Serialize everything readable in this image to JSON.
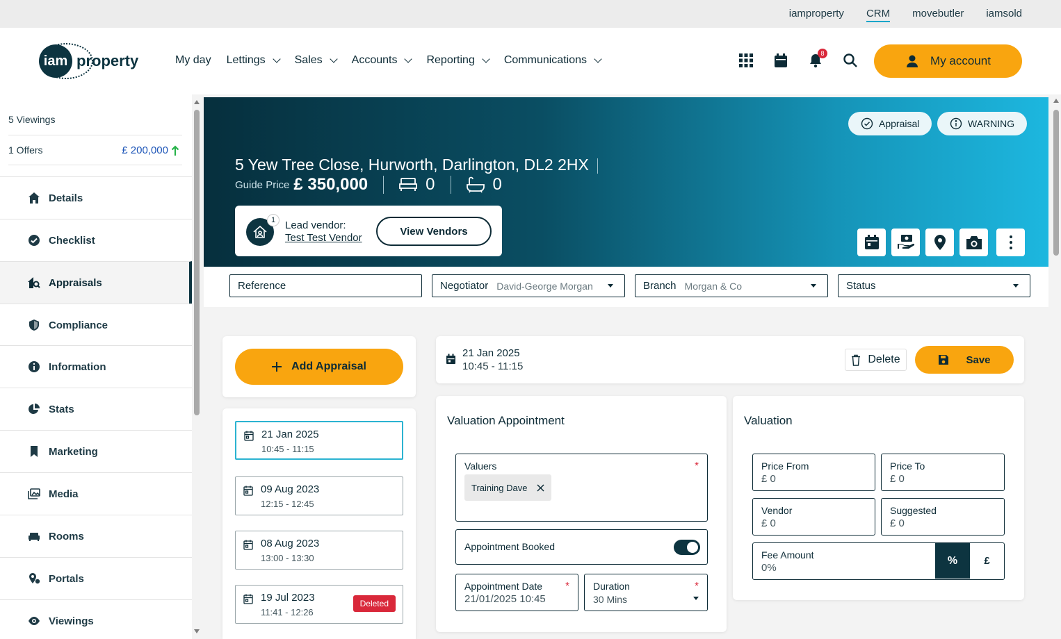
{
  "topbar": {
    "links": [
      "iamproperty",
      "CRM",
      "movebutler",
      "iamsold"
    ],
    "active_link": "CRM"
  },
  "header": {
    "logo": {
      "mark": "iam",
      "word": "property"
    },
    "nav": [
      "My day",
      "Lettings",
      "Sales",
      "Accounts",
      "Reporting",
      "Communications"
    ],
    "notification_count": "8",
    "account_label": "My account"
  },
  "sidebar": {
    "viewings": "5 Viewings",
    "offers": "1 Offers",
    "offer_value": "£ 200,000",
    "items": [
      "Details",
      "Checklist",
      "Appraisals",
      "Compliance",
      "Information",
      "Stats",
      "Marketing",
      "Media",
      "Rooms",
      "Portals",
      "Viewings"
    ],
    "active_item": "Appraisals"
  },
  "property": {
    "address": "5 Yew Tree Close, Hurworth, Darlington, DL2 2HX",
    "guide_label": "Guide Price",
    "guide_price": "£ 350,000",
    "bedrooms": "0",
    "bathrooms": "0",
    "status_pills": [
      "Appraisal",
      "WARNING"
    ],
    "vendor_count": "1",
    "lead_vendor_label": "Lead vendor:",
    "lead_vendor_name": "Test Test Vendor",
    "view_vendors_label": "View Vendors"
  },
  "filters": {
    "reference": "Reference",
    "negotiator_label": "Negotiator",
    "negotiator_value": "David-George Morgan",
    "branch_label": "Branch",
    "branch_value": "Morgan & Co",
    "status_label": "Status"
  },
  "appraisals": {
    "add_label": "Add Appraisal",
    "list": [
      {
        "date": "21 Jan 2025",
        "time": "10:45 - 11:15"
      },
      {
        "date": "09 Aug 2023",
        "time": "12:15 - 12:45"
      },
      {
        "date": "08 Aug 2023",
        "time": "13:00 - 13:30"
      },
      {
        "date": "19 Jul 2023",
        "time": "11:41 - 12:26",
        "tag": "Deleted"
      }
    ]
  },
  "selected": {
    "date": "21 Jan 2025",
    "time": "10:45 - 11:15",
    "delete_label": "Delete",
    "save_label": "Save"
  },
  "valuation_appointment": {
    "title": "Valuation Appointment",
    "valuers_label": "Valuers",
    "valuer_chip": "Training Dave",
    "booked_label": "Appointment Booked",
    "booked": true,
    "date_label": "Appointment Date",
    "date_value": "21/01/2025 10:45",
    "duration_label": "Duration",
    "duration_value": "30 Mins"
  },
  "valuation": {
    "title": "Valuation",
    "price_from_label": "Price From",
    "price_from_value": "£ 0",
    "price_to_label": "Price To",
    "price_to_value": "£ 0",
    "vendor_label": "Vendor",
    "vendor_value": "£ 0",
    "suggested_label": "Suggested",
    "suggested_value": "£ 0",
    "fee_label": "Fee Amount",
    "fee_value": "0%",
    "pct_label": "%",
    "gbp_label": "£"
  },
  "colors": {
    "brand_dark": "#0d3440",
    "accent": "#f9a50f",
    "danger": "#d9283a",
    "highlight": "#2bb3d1"
  }
}
